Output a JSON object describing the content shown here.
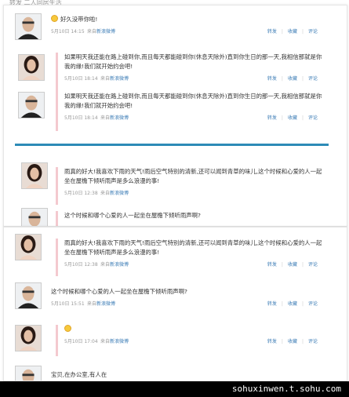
{
  "top_strip": {
    "text": "转发 二人同居生活"
  },
  "meta_labels": {
    "repost": "转发",
    "favorite": "收藏",
    "comment": "评论",
    "source_prefix": "来自",
    "source_link": "新浪微博"
  },
  "posts": [
    {
      "text": "好久没带你啦!",
      "emoji": true,
      "time": "5月10日 14:15"
    },
    {
      "text": "如果明天我还能在路上碰到你,而且每天都能碰到你(休息天除外)直到你生日的那一天,我相信那就是你我的缘!我们就开始约会吧!",
      "time": "5月10日 18:14"
    },
    {
      "text": "如果明天我还能在路上碰到你,而且每天都能碰到你(休息天除外)直到你生日的那一天,我相信那就是你我的缘!我们就开始约会吧!",
      "time": "5月10日 18:14"
    },
    {
      "text": "雨真的好大!我喜欢下雨的天气!雨后空气特别的清新,还可以闻到青草的味儿,这个时候和心爱的人一起坐在屋檐下倾听雨声是多么浪漫的事!",
      "time": "5月10日 12:38"
    },
    {
      "text": "这个时候和哪个心爱的人一起坐在屋檐下倾听雨声啊?"
    },
    {
      "text": "雨真的好大!我喜欢下雨的天气!雨后空气特别的清新,还可以闻到青草的味儿,这个时候和心爱的人一起坐在屋檐下倾听雨声是多么浪漫的事!",
      "time": "5月10日 12:38"
    },
    {
      "text": "这个时候和哪个心爱的人一起坐在屋檐下倾听雨声啊?",
      "time": "5月10日 15:51"
    },
    {
      "text": "",
      "emoji": true,
      "time": "5月10日 17:04"
    },
    {
      "text": "宝贝,在办公室,有人在"
    }
  ],
  "watermark": "sohuxinwen.t.sohu.com",
  "colors": {
    "link": "#3a7bb5",
    "divider": "#2d8bb7",
    "reply_border": "#f4c9cf",
    "watermark_bg": "#000000"
  }
}
